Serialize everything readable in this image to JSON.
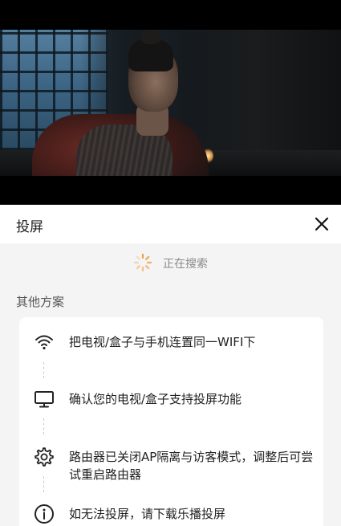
{
  "panel": {
    "title": "投屏",
    "searching_text": "正在搜索",
    "section_title": "其他方案"
  },
  "steps": [
    {
      "icon": "wifi-icon",
      "text": "把电视/盒子与手机连置同一WIFI下"
    },
    {
      "icon": "tv-monitor-icon",
      "text": "确认您的电视/盒子支持投屏功能"
    },
    {
      "icon": "gear-icon",
      "text": "路由器已关闭AP隔离与访客模式，调整后可尝试重启路由器"
    },
    {
      "icon": "info-icon",
      "text": "如无法投屏，请下载乐播投屏"
    }
  ],
  "colors": {
    "spinner": "#f0a040",
    "background": "#f4f4f4"
  }
}
